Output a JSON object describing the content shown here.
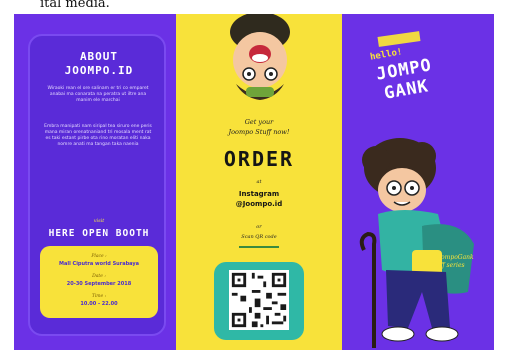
{
  "caption": "ital media.",
  "left_panel": {
    "about_title_line1": "ABOUT",
    "about_title_line2": "JOOMPO.ID",
    "paragraph1": "Wiraoki rean el ore salinam er tri co emparet anabai ma conarata na peratra ut iltre ana manim ele marchai",
    "paragraph2": "Embra manipati nam siripal tea siruro ene peris mana miran orenatnaniand tri mosala ment rat es taki estant pirbe ota rino moratan eliti naka nomre anati ma tangan taka naenia",
    "booth_script": "visit",
    "booth_title": "HERE OPEN BOOTH",
    "place_label": "Place :",
    "place_value": "Mall Ciputra world Surabaya",
    "date_label": "Date :",
    "date_value": "20-30 September 2018",
    "time_label": "Time :",
    "time_value": "10.00 - 22.00"
  },
  "middle_panel": {
    "script_line1": "Get your",
    "script_line2": "Joompo Stuff now!",
    "order_title": "ORDER",
    "at_text": "at",
    "ig_line1": "Instagram",
    "ig_line2": "@Joompo.id",
    "or_text": "or",
    "scan_text": "Scan QR code"
  },
  "right_panel": {
    "hello": "hello!",
    "title_line1": "JOMPO",
    "title_line2": "GANK",
    "script_note": "#JoompoGank Stuff series"
  },
  "colors": {
    "purple": "#6b31e6",
    "yellow": "#f8e23a",
    "teal": "#2fb8a6"
  }
}
